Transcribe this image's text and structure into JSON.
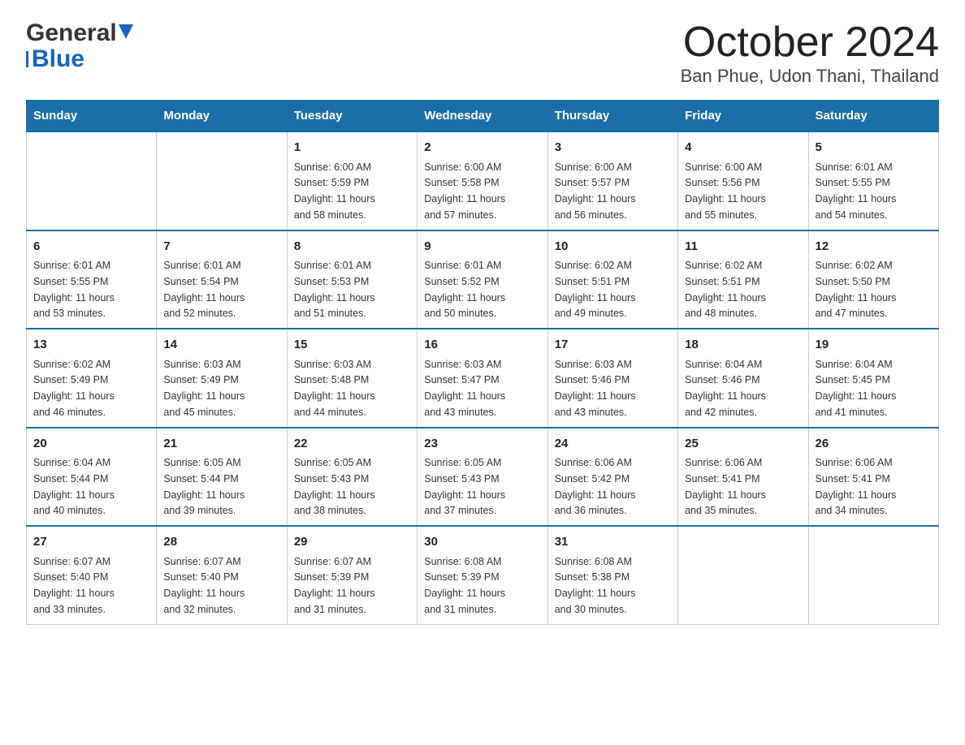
{
  "header": {
    "logo": {
      "general": "General",
      "blue": "Blue"
    },
    "title": "October 2024",
    "location": "Ban Phue, Udon Thani, Thailand"
  },
  "days_of_week": [
    "Sunday",
    "Monday",
    "Tuesday",
    "Wednesday",
    "Thursday",
    "Friday",
    "Saturday"
  ],
  "weeks": [
    [
      {
        "day": "",
        "info": ""
      },
      {
        "day": "",
        "info": ""
      },
      {
        "day": "1",
        "info": "Sunrise: 6:00 AM\nSunset: 5:59 PM\nDaylight: 11 hours\nand 58 minutes."
      },
      {
        "day": "2",
        "info": "Sunrise: 6:00 AM\nSunset: 5:58 PM\nDaylight: 11 hours\nand 57 minutes."
      },
      {
        "day": "3",
        "info": "Sunrise: 6:00 AM\nSunset: 5:57 PM\nDaylight: 11 hours\nand 56 minutes."
      },
      {
        "day": "4",
        "info": "Sunrise: 6:00 AM\nSunset: 5:56 PM\nDaylight: 11 hours\nand 55 minutes."
      },
      {
        "day": "5",
        "info": "Sunrise: 6:01 AM\nSunset: 5:55 PM\nDaylight: 11 hours\nand 54 minutes."
      }
    ],
    [
      {
        "day": "6",
        "info": "Sunrise: 6:01 AM\nSunset: 5:55 PM\nDaylight: 11 hours\nand 53 minutes."
      },
      {
        "day": "7",
        "info": "Sunrise: 6:01 AM\nSunset: 5:54 PM\nDaylight: 11 hours\nand 52 minutes."
      },
      {
        "day": "8",
        "info": "Sunrise: 6:01 AM\nSunset: 5:53 PM\nDaylight: 11 hours\nand 51 minutes."
      },
      {
        "day": "9",
        "info": "Sunrise: 6:01 AM\nSunset: 5:52 PM\nDaylight: 11 hours\nand 50 minutes."
      },
      {
        "day": "10",
        "info": "Sunrise: 6:02 AM\nSunset: 5:51 PM\nDaylight: 11 hours\nand 49 minutes."
      },
      {
        "day": "11",
        "info": "Sunrise: 6:02 AM\nSunset: 5:51 PM\nDaylight: 11 hours\nand 48 minutes."
      },
      {
        "day": "12",
        "info": "Sunrise: 6:02 AM\nSunset: 5:50 PM\nDaylight: 11 hours\nand 47 minutes."
      }
    ],
    [
      {
        "day": "13",
        "info": "Sunrise: 6:02 AM\nSunset: 5:49 PM\nDaylight: 11 hours\nand 46 minutes."
      },
      {
        "day": "14",
        "info": "Sunrise: 6:03 AM\nSunset: 5:49 PM\nDaylight: 11 hours\nand 45 minutes."
      },
      {
        "day": "15",
        "info": "Sunrise: 6:03 AM\nSunset: 5:48 PM\nDaylight: 11 hours\nand 44 minutes."
      },
      {
        "day": "16",
        "info": "Sunrise: 6:03 AM\nSunset: 5:47 PM\nDaylight: 11 hours\nand 43 minutes."
      },
      {
        "day": "17",
        "info": "Sunrise: 6:03 AM\nSunset: 5:46 PM\nDaylight: 11 hours\nand 43 minutes."
      },
      {
        "day": "18",
        "info": "Sunrise: 6:04 AM\nSunset: 5:46 PM\nDaylight: 11 hours\nand 42 minutes."
      },
      {
        "day": "19",
        "info": "Sunrise: 6:04 AM\nSunset: 5:45 PM\nDaylight: 11 hours\nand 41 minutes."
      }
    ],
    [
      {
        "day": "20",
        "info": "Sunrise: 6:04 AM\nSunset: 5:44 PM\nDaylight: 11 hours\nand 40 minutes."
      },
      {
        "day": "21",
        "info": "Sunrise: 6:05 AM\nSunset: 5:44 PM\nDaylight: 11 hours\nand 39 minutes."
      },
      {
        "day": "22",
        "info": "Sunrise: 6:05 AM\nSunset: 5:43 PM\nDaylight: 11 hours\nand 38 minutes."
      },
      {
        "day": "23",
        "info": "Sunrise: 6:05 AM\nSunset: 5:43 PM\nDaylight: 11 hours\nand 37 minutes."
      },
      {
        "day": "24",
        "info": "Sunrise: 6:06 AM\nSunset: 5:42 PM\nDaylight: 11 hours\nand 36 minutes."
      },
      {
        "day": "25",
        "info": "Sunrise: 6:06 AM\nSunset: 5:41 PM\nDaylight: 11 hours\nand 35 minutes."
      },
      {
        "day": "26",
        "info": "Sunrise: 6:06 AM\nSunset: 5:41 PM\nDaylight: 11 hours\nand 34 minutes."
      }
    ],
    [
      {
        "day": "27",
        "info": "Sunrise: 6:07 AM\nSunset: 5:40 PM\nDaylight: 11 hours\nand 33 minutes."
      },
      {
        "day": "28",
        "info": "Sunrise: 6:07 AM\nSunset: 5:40 PM\nDaylight: 11 hours\nand 32 minutes."
      },
      {
        "day": "29",
        "info": "Sunrise: 6:07 AM\nSunset: 5:39 PM\nDaylight: 11 hours\nand 31 minutes."
      },
      {
        "day": "30",
        "info": "Sunrise: 6:08 AM\nSunset: 5:39 PM\nDaylight: 11 hours\nand 31 minutes."
      },
      {
        "day": "31",
        "info": "Sunrise: 6:08 AM\nSunset: 5:38 PM\nDaylight: 11 hours\nand 30 minutes."
      },
      {
        "day": "",
        "info": ""
      },
      {
        "day": "",
        "info": ""
      }
    ]
  ]
}
